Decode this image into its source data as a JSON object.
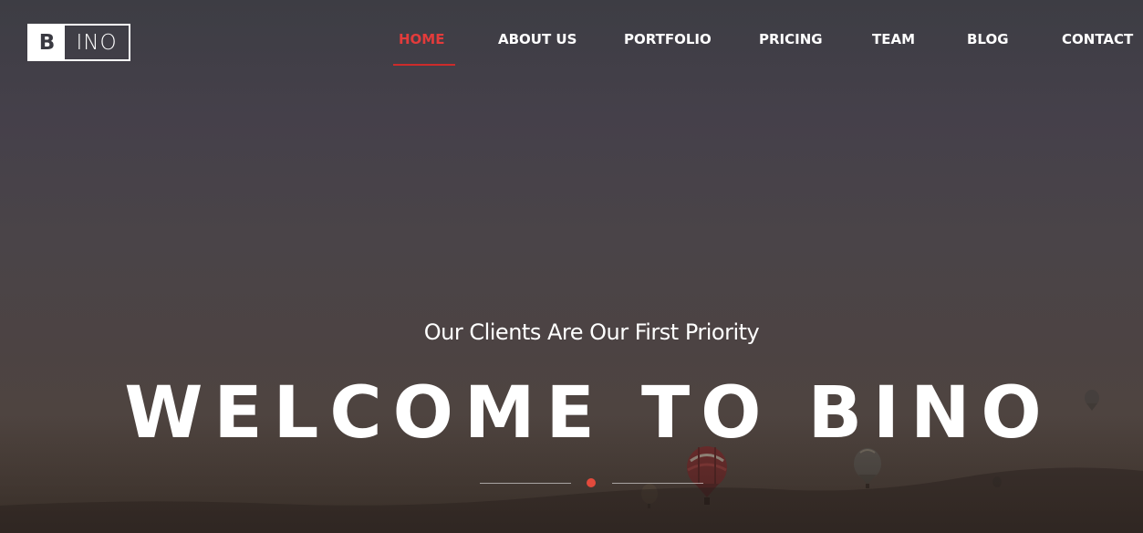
{
  "logo": {
    "letter": "B",
    "rest": "INO"
  },
  "nav": {
    "items": [
      {
        "label": "HOME",
        "active": true
      },
      {
        "label": "ABOUT US",
        "active": false
      },
      {
        "label": "PORTFOLIO",
        "active": false
      },
      {
        "label": "PRICING",
        "active": false
      },
      {
        "label": "TEAM",
        "active": false
      },
      {
        "label": "BLOG",
        "active": false
      },
      {
        "label": "CONTACT",
        "active": false
      }
    ]
  },
  "hero": {
    "subtitle": "Our Clients Are Our First Priority",
    "title": "WELCOME TO BINO"
  },
  "colors": {
    "accent": "#e33b3b",
    "dot": "#e24a3c",
    "text": "#ffffff"
  }
}
